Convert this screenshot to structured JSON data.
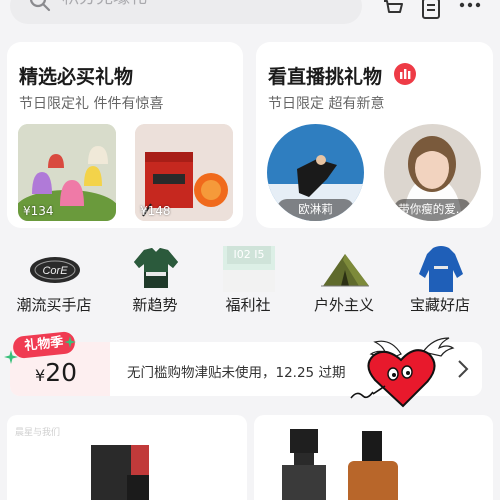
{
  "search": {
    "placeholder": "积分兑壕礼"
  },
  "header_icons": [
    "cart-icon",
    "list-icon",
    "more-icon"
  ],
  "cards": [
    {
      "title": "精选必买礼物",
      "subtitle": "节日限定礼 件件有惊喜",
      "items": [
        {
          "price": "¥134"
        },
        {
          "price": "¥148"
        }
      ]
    },
    {
      "title": "看直播挑礼物",
      "subtitle": "节日限定 超有新意",
      "streamers": [
        {
          "name": "欧淋莉"
        },
        {
          "name": "带你瘦的爱..."
        }
      ]
    }
  ],
  "categories": [
    {
      "label": "潮流买手店",
      "icon": "core-logo-icon"
    },
    {
      "label": "新趋势",
      "icon": "jacket-icon"
    },
    {
      "label": "福利社",
      "icon": "welfare-icon",
      "icon_text": "I02 I5"
    },
    {
      "label": "户外主义",
      "icon": "tent-icon"
    },
    {
      "label": "宝藏好店",
      "icon": "hoodie-icon"
    }
  ],
  "coupon": {
    "badge": "礼物季",
    "currency": "¥",
    "amount": "20",
    "text": "无门槛购物津贴未使用，12.25 过期"
  },
  "bottom_cards": [
    {
      "label": "晨星与我们"
    },
    {
      "label": ""
    }
  ],
  "colors": {
    "accent": "#f03b52",
    "background": "#f4f4f6",
    "card": "#ffffff"
  }
}
